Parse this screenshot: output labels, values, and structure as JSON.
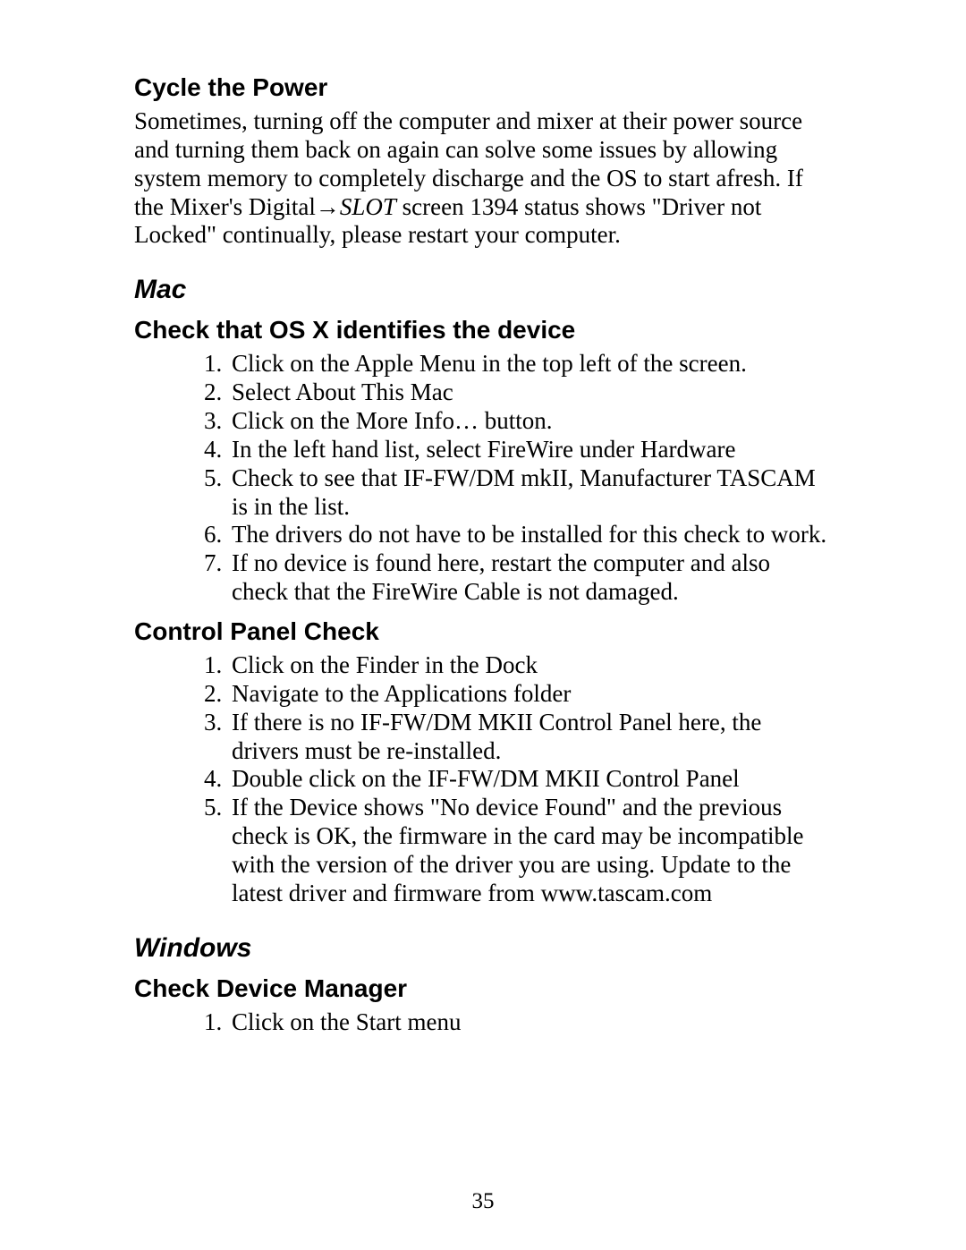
{
  "section_cycle": {
    "heading": "Cycle the Power",
    "para_pre": "Sometimes, turning off the computer and mixer at their power source and turning them back on again can solve some issues by allowing system memory to completely discharge and the OS to start afresh. If the Mixer's Digital",
    "arrow": "→",
    "slot": "SLOT",
    "para_post": " screen 1394 status shows \"Driver not Locked\" continually, please restart your computer."
  },
  "section_mac": {
    "heading": "Mac",
    "sub_check_osx": {
      "heading": "Check that OS X identifies the device",
      "items": [
        "Click on the Apple Menu in the top left of the screen.",
        "Select About This Mac",
        "Click on the More Info… button.",
        "In the left hand list, select FireWire under Hardware",
        "Check to see that IF-FW/DM mkII, Manufacturer TASCAM is in the list.",
        "The drivers do not have to be installed for this check to work.",
        "If no device is found here, restart the computer and also check that the FireWire Cable is not damaged."
      ]
    },
    "sub_control_panel": {
      "heading": "Control Panel Check",
      "items": [
        "Click on the Finder in the Dock",
        "Navigate to the Applications folder",
        "If there is no IF-FW/DM MKII Control Panel here, the drivers must be re-installed.",
        "Double click on the IF-FW/DM MKII Control Panel",
        "If the Device shows \"No device Found\" and the previous check is OK, the firmware in the card may be incompatible with the version of the driver you are using. Update to the latest driver and firmware from www.tascam.com"
      ]
    }
  },
  "section_windows": {
    "heading": "Windows",
    "sub_device_mgr": {
      "heading": "Check Device Manager",
      "items": [
        "Click on the Start menu"
      ]
    }
  },
  "page_number": "35"
}
